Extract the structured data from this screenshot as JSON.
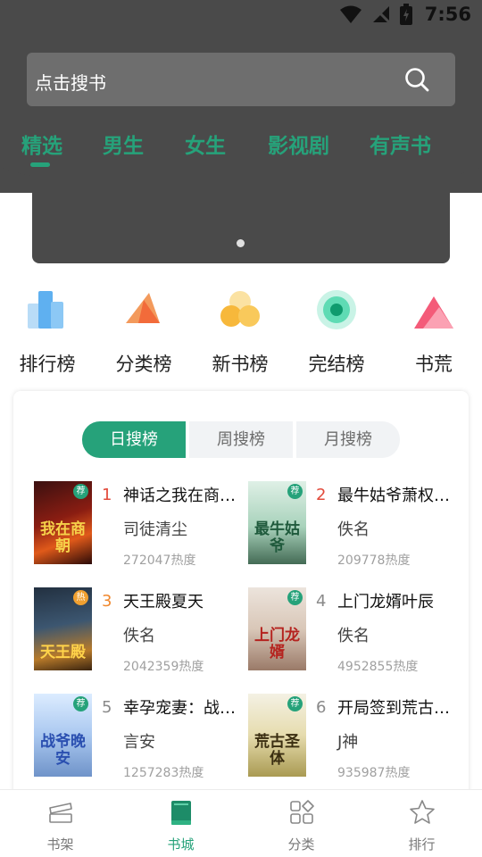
{
  "status_bar": {
    "time": "7:56"
  },
  "search": {
    "placeholder": "点击搜书"
  },
  "category_tabs": [
    {
      "label": "精选",
      "selected": true
    },
    {
      "label": "男生"
    },
    {
      "label": "女生"
    },
    {
      "label": "影视剧"
    },
    {
      "label": "有声书"
    }
  ],
  "shortcuts": [
    {
      "label": "排行榜",
      "icon": "bar-chart-icon"
    },
    {
      "label": "分类榜",
      "icon": "pyramid-icon"
    },
    {
      "label": "新书榜",
      "icon": "bubbles-icon"
    },
    {
      "label": "完结榜",
      "icon": "target-icon"
    },
    {
      "label": "书荒",
      "icon": "mountain-icon"
    }
  ],
  "ranking": {
    "tabs": [
      {
        "label": "日搜榜",
        "selected": true
      },
      {
        "label": "周搜榜"
      },
      {
        "label": "月搜榜"
      }
    ],
    "books": [
      {
        "rank": "1",
        "title": "神话之我在商朝当守陵人",
        "author": "司徒清尘",
        "heat": "272047热度",
        "badge": "荐",
        "cover_text": "我在商朝"
      },
      {
        "rank": "2",
        "title": "最牛姑爷萧权秦舒柔",
        "author": "佚名",
        "heat": "209778热度",
        "badge": "荐",
        "cover_text": "最牛姑爷"
      },
      {
        "rank": "3",
        "title": "天王殿夏天",
        "author": "佚名",
        "heat": "2042359热度",
        "badge": "热",
        "cover_text": "天王殿"
      },
      {
        "rank": "4",
        "title": "上门龙婿叶辰",
        "author": "佚名",
        "heat": "4952855热度",
        "badge": "荐",
        "cover_text": "上门龙婿"
      },
      {
        "rank": "5",
        "title": "幸孕宠妻：战爷晚安",
        "author": "言安",
        "heat": "1257283热度",
        "badge": "荐",
        "cover_text": "战爷晚安"
      },
      {
        "rank": "6",
        "title": "开局签到荒古圣体",
        "author": "J神",
        "heat": "935987热度",
        "badge": "荐",
        "cover_text": "荒古圣体"
      }
    ]
  },
  "bottom_nav": [
    {
      "label": "书架",
      "icon": "bookshelf-icon"
    },
    {
      "label": "书城",
      "icon": "book-icon",
      "selected": true
    },
    {
      "label": "分类",
      "icon": "category-grid-icon"
    },
    {
      "label": "排行",
      "icon": "star-icon"
    }
  ],
  "colors": {
    "accent": "#26a27a",
    "header": "#4a4a4a",
    "search_bg": "#6e6e6e"
  }
}
